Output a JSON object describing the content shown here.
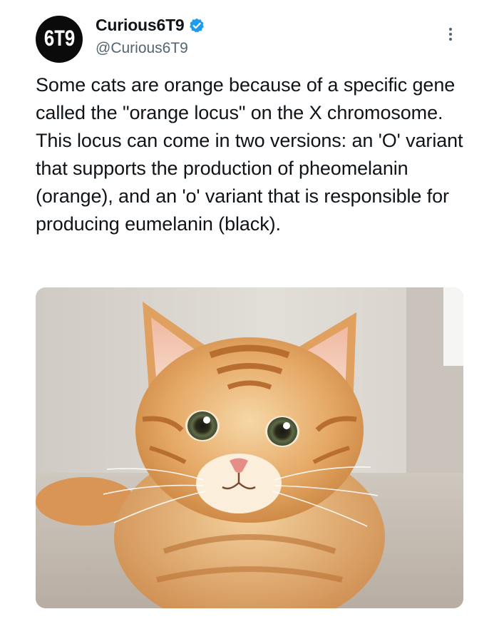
{
  "author": {
    "display_name": "Curious6T9",
    "handle": "@Curious6T9",
    "avatar_text": "6T9",
    "verified_color": "#1d9bf0"
  },
  "tweet": {
    "text": "Some cats are orange because of a specific gene called the \"orange locus\" on the X chromosome. This locus can come in two versions: an 'O' variant that supports the production of pheomelanin (orange), and an 'o' variant that is responsible for producing eumelanin (black)."
  },
  "media": {
    "subject": "orange tabby kitten photo"
  },
  "icons": {
    "more": "more-options-icon",
    "verified": "verified-badge-icon"
  },
  "colors": {
    "text": "#0f1419",
    "secondary": "#536471",
    "accent": "#1d9bf0"
  }
}
